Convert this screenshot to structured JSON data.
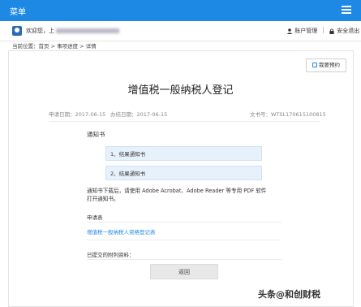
{
  "topbar": {
    "menu_label": "菜单"
  },
  "user": {
    "welcome": "欢迎您，上",
    "account_label": "账户管理",
    "separator": "|",
    "logout_label": "安全退出"
  },
  "breadcrumb": "当前位置：首页 > 事项进度 > 详情",
  "book_button": "我要预约",
  "title": "增值税一般纳税人登记",
  "meta": {
    "apply_date": "申请日期：2017-06-15",
    "process_date": "办结日期：2017-06-15",
    "doc_no": "文书号：WTSL170615100815"
  },
  "notice_section": {
    "title": "通知书",
    "items": [
      "1、结果通知书",
      "2、结果通知书"
    ]
  },
  "paragraph": "通知书下载后，请使用 Adobe Acrobat、Adobe Reader 等专用 PDF 软件打开通知书。",
  "application_section": {
    "title": "申请表",
    "link": "增值税一般纳税人资格登记表"
  },
  "attachments_label": "已提交的附列资料：",
  "back_button": "返回",
  "watermark": "头条@和创财税",
  "colors": {
    "primary": "#1e88e5",
    "notice_bg": "#e7f1fb"
  }
}
